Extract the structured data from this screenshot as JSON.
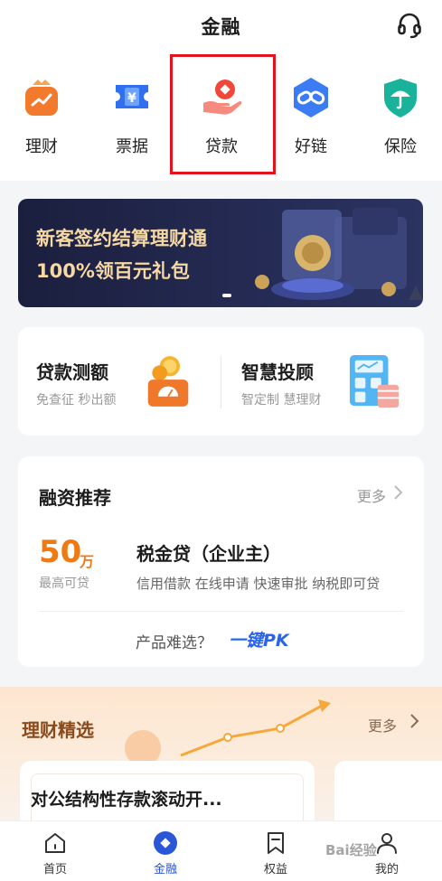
{
  "header": {
    "title": "金融",
    "service_icon": "headset-icon"
  },
  "quick_entries": [
    {
      "label": "理财",
      "icon": "wealth-bag-icon",
      "color": "#f37a2c"
    },
    {
      "label": "票据",
      "icon": "bill-ticket-icon",
      "color": "#2f6ff0"
    },
    {
      "label": "贷款",
      "icon": "loan-hand-icon",
      "color": "#f0473a",
      "selected": true
    },
    {
      "label": "好链",
      "icon": "chain-link-icon",
      "color": "#3b7cf5"
    },
    {
      "label": "保险",
      "icon": "insurance-umbrella-icon",
      "color": "#18b39a"
    }
  ],
  "banner": {
    "line1": "新客签约结算理财通",
    "line2": "100%领百元礼包"
  },
  "services": [
    {
      "title": "贷款测额",
      "subtitle": "免查征 秒出额",
      "icon": "coin-scale-icon"
    },
    {
      "title": "智慧投顾",
      "subtitle": "智定制 慧理财",
      "icon": "calculator-icon"
    }
  ],
  "financing": {
    "title": "融资推荐",
    "more": "更多",
    "amount": "50",
    "amount_unit": "万",
    "amount_label": "最高可贷",
    "product_name": "税金贷（企业主）",
    "product_tags": "信用借款 在线申请 快速审批 纳税即可贷",
    "pk_prompt": "产品难选？",
    "pk_logo": "一键PK"
  },
  "wealth": {
    "title": "理财精选",
    "more": "更多",
    "card_title": "对公结构性存款滚动开..."
  },
  "tabbar": [
    {
      "label": "首页",
      "icon": "home-icon",
      "active": false
    },
    {
      "label": "金融",
      "icon": "finance-diamond-icon",
      "active": true
    },
    {
      "label": "权益",
      "icon": "bookmark-icon",
      "active": false
    },
    {
      "label": "我的",
      "icon": "profile-icon",
      "active": false
    }
  ],
  "watermark": "Bai经验"
}
